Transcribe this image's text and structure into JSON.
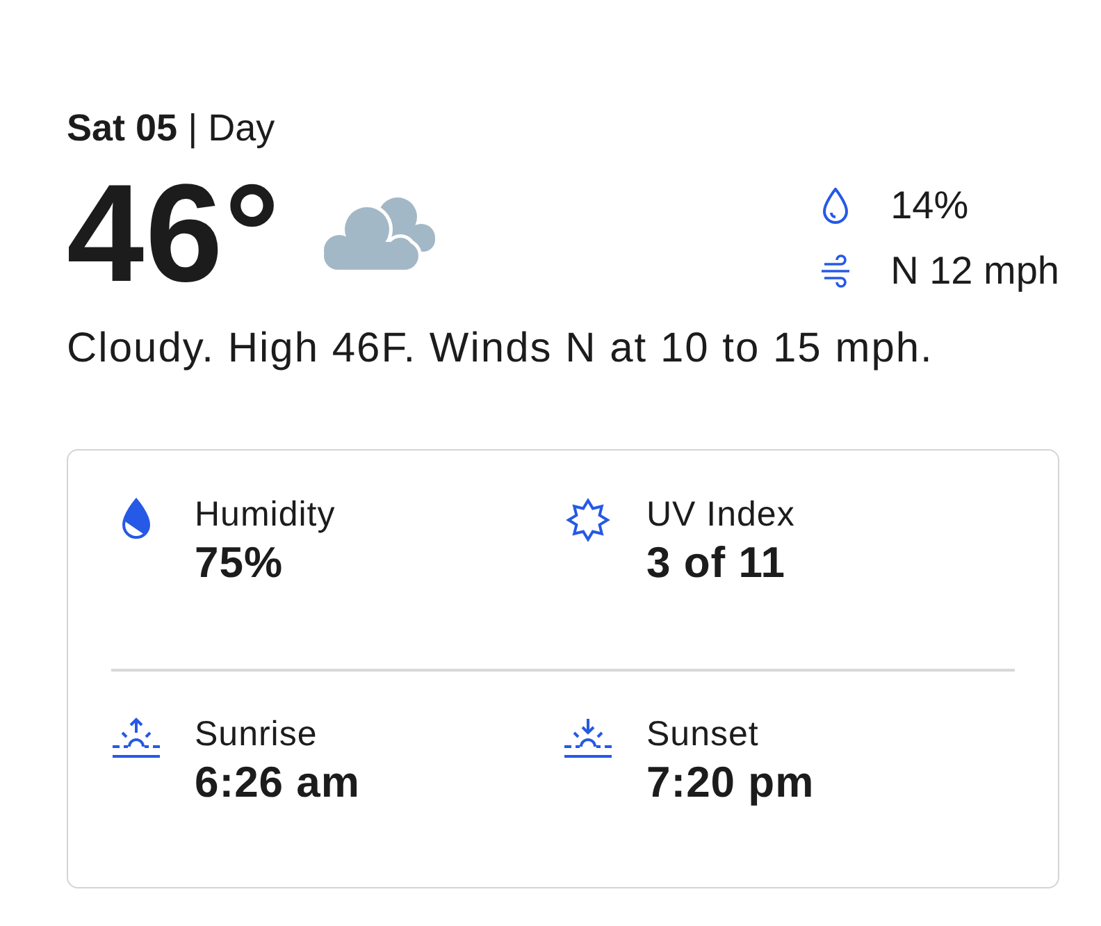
{
  "header": {
    "date": "**Sat 05** | Day"
  },
  "current": {
    "temperature": "46°",
    "stats": [
      {
        "kind": "precipitation",
        "value": "14%"
      },
      {
        "kind": "wind",
        "value": "N 12 mph"
      }
    ],
    "description": "Cloudy. High 46F. Winds N at 10 to 15 mph."
  },
  "details": {
    "rows": [
      [
        {
          "kind": "humidity",
          "label": "Humidity",
          "value": "75%"
        },
        {
          "kind": "uv",
          "label": "UV Index",
          "value": "3 of 11"
        }
      ],
      [
        {
          "kind": "sunrise",
          "label": "Sunrise",
          "value": "6:26 am"
        },
        {
          "kind": "sunset",
          "label": "Sunset",
          "value": "7:20 pm"
        }
      ]
    ]
  }
}
